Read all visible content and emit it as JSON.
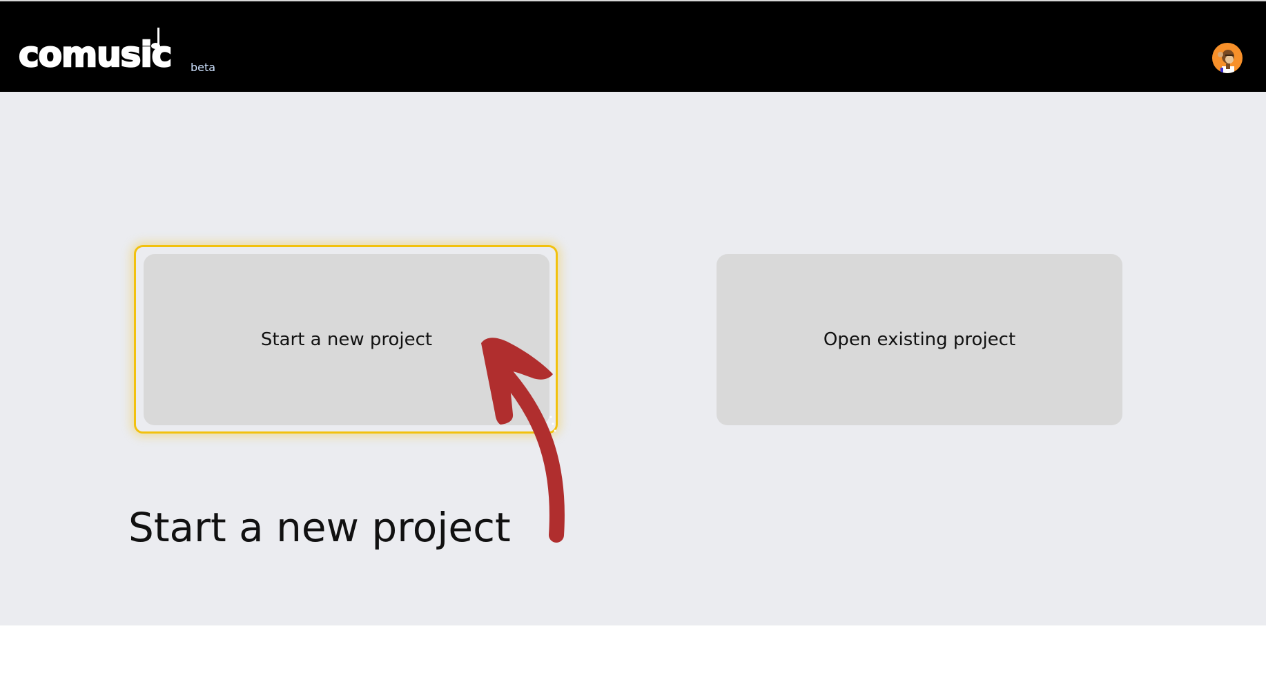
{
  "header": {
    "logo": "comusic",
    "badge": "beta",
    "avatar_icon": "ape-avatar-icon"
  },
  "main": {
    "cards": [
      {
        "label": "Start a new project",
        "highlighted": true
      },
      {
        "label": "Open existing project",
        "highlighted": false
      }
    ],
    "annotation_heading": "Start a new project"
  },
  "colors": {
    "header_bg": "#000000",
    "page_bg": "#ebecf0",
    "card_bg": "#d9d9d9",
    "highlight": "#f2c10e",
    "arrow": "#b02e2e",
    "avatar_bg": "#f7902a"
  }
}
